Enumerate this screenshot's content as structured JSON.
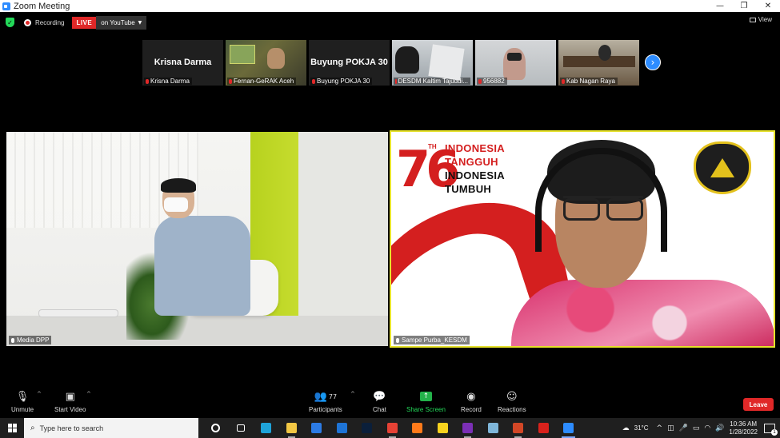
{
  "window": {
    "title": "Zoom Meeting",
    "controls": {
      "minimize": "—",
      "restore": "❐",
      "close": "✕"
    }
  },
  "topbar": {
    "recording_label": "Recording",
    "live_badge": "LIVE",
    "youtube_label": "on YouTube",
    "view_label": "View"
  },
  "thumbnails": [
    {
      "big_name": "Krisna Darma",
      "label": "Krisna Darma",
      "type": "name"
    },
    {
      "big_name": "",
      "label": "Fernan-GeRAK Aceh",
      "type": "video1"
    },
    {
      "big_name": "Buyung POKJA 30",
      "label": "Buyung POKJA 30",
      "type": "name"
    },
    {
      "big_name": "",
      "label": "DESDM Kaltim Tajuddi...",
      "type": "video2"
    },
    {
      "big_name": "",
      "label": "956882",
      "type": "video3"
    },
    {
      "big_name": "",
      "label": "Kab Nagan Raya",
      "type": "video4"
    }
  ],
  "main_videos": {
    "left": {
      "label": "Media DPP"
    },
    "right": {
      "label": "Sampe Purba_KESDM",
      "poster_number": "76",
      "poster_th": "TH",
      "poster_line1": "INDONESIA",
      "poster_line2": "TANGGUH",
      "poster_line3": "INDONESIA",
      "poster_line4": "TUMBUH"
    }
  },
  "toolbar": {
    "unmute": "Unmute",
    "start_video": "Start Video",
    "participants": "Participants",
    "participants_count": "77",
    "chat": "Chat",
    "share_screen": "Share Screen",
    "record": "Record",
    "reactions": "Reactions",
    "leave": "Leave"
  },
  "taskbar": {
    "search_placeholder": "Type here to search",
    "temperature": "31°C",
    "time": "10:36 AM",
    "date": "1/28/2022",
    "notification_count": "1",
    "apps": [
      {
        "name": "cortana-icon",
        "color": "#1f1f1f",
        "state": ""
      },
      {
        "name": "task-view-icon",
        "color": "#1f1f1f",
        "state": ""
      },
      {
        "name": "edge-icon",
        "color": "#1fa3d9",
        "state": ""
      },
      {
        "name": "file-explorer-icon",
        "color": "#f2c744",
        "state": "open"
      },
      {
        "name": "store-icon",
        "color": "#2c7be5",
        "state": ""
      },
      {
        "name": "mail-icon",
        "color": "#1e74d6",
        "state": ""
      },
      {
        "name": "photoshop-icon",
        "color": "#0b1f3a",
        "state": ""
      },
      {
        "name": "chrome-icon",
        "color": "#e64235",
        "state": "open"
      },
      {
        "name": "firefox-icon",
        "color": "#ff7a1a",
        "state": ""
      },
      {
        "name": "sticky-notes-icon",
        "color": "#f7d21e",
        "state": ""
      },
      {
        "name": "onenote-icon",
        "color": "#7b2fb5",
        "state": "open"
      },
      {
        "name": "notepad-icon",
        "color": "#7fb6d9",
        "state": ""
      },
      {
        "name": "powerpoint-icon",
        "color": "#d24726",
        "state": "open"
      },
      {
        "name": "acrobat-icon",
        "color": "#d9221c",
        "state": ""
      },
      {
        "name": "zoom-icon",
        "color": "#2d8cff",
        "state": "active"
      }
    ]
  }
}
